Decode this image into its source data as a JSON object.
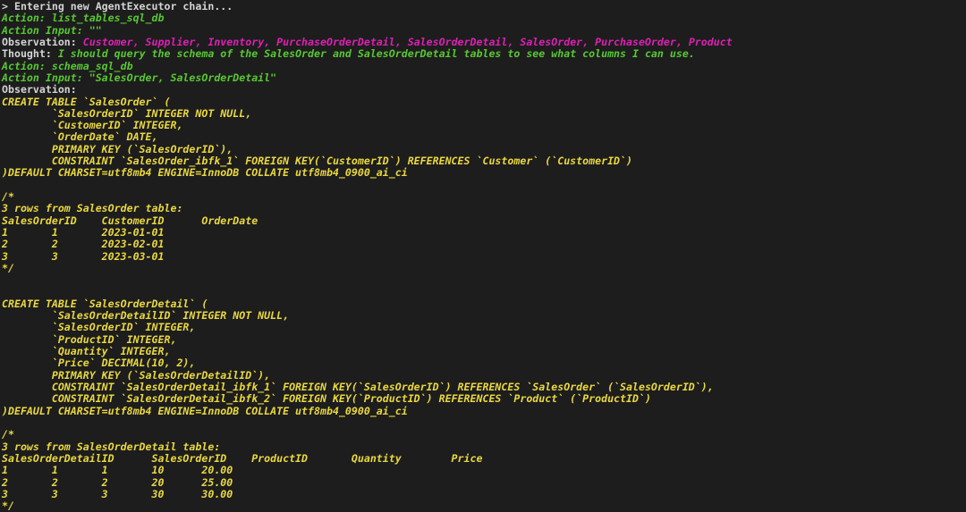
{
  "terminal": {
    "background_color": "#1d1d1d",
    "colors": {
      "plain": "#d4d4d4",
      "green": "#58c832",
      "magenta": "#de1fb5",
      "yellow": "#ead83f"
    },
    "lines": [
      {
        "id": "l0",
        "color": "plain",
        "text": "> Entering new AgentExecutor chain..."
      },
      {
        "id": "l1",
        "color": "green",
        "text": "Action: list_tables_sql_db"
      },
      {
        "id": "l2",
        "color": "green",
        "text": "Action Input: \"\""
      },
      {
        "id": "l3",
        "color": "plain",
        "text": "Observation: ",
        "suffix_color": "magenta",
        "suffix": "Customer, Supplier, Inventory, PurchaseOrderDetail, SalesOrderDetail, SalesOrder, PurchaseOrder, Product"
      },
      {
        "id": "l4",
        "color": "plain",
        "text": "Thought: ",
        "suffix_color": "green",
        "suffix": "I should query the schema of the SalesOrder and SalesOrderDetail tables to see what columns I can use."
      },
      {
        "id": "l5",
        "color": "green",
        "text": "Action: schema_sql_db"
      },
      {
        "id": "l6",
        "color": "green",
        "text": "Action Input: \"SalesOrder, SalesOrderDetail\""
      },
      {
        "id": "l7",
        "color": "plain",
        "text": "Observation:"
      },
      {
        "id": "l8",
        "color": "yellow",
        "text": "CREATE TABLE `SalesOrder` ("
      },
      {
        "id": "l9",
        "color": "yellow",
        "text": "        `SalesOrderID` INTEGER NOT NULL,"
      },
      {
        "id": "l10",
        "color": "yellow",
        "text": "        `CustomerID` INTEGER,"
      },
      {
        "id": "l11",
        "color": "yellow",
        "text": "        `OrderDate` DATE,"
      },
      {
        "id": "l12",
        "color": "yellow",
        "text": "        PRIMARY KEY (`SalesOrderID`),"
      },
      {
        "id": "l13",
        "color": "yellow",
        "text": "        CONSTRAINT `SalesOrder_ibfk_1` FOREIGN KEY(`CustomerID`) REFERENCES `Customer` (`CustomerID`)"
      },
      {
        "id": "l14",
        "color": "yellow",
        "text": ")DEFAULT CHARSET=utf8mb4 ENGINE=InnoDB COLLATE utf8mb4_0900_ai_ci"
      },
      {
        "id": "l15",
        "color": "yellow",
        "text": ""
      },
      {
        "id": "l16",
        "color": "yellow",
        "text": "/*"
      },
      {
        "id": "l17",
        "color": "yellow",
        "text": "3 rows from SalesOrder table:"
      },
      {
        "id": "l18",
        "color": "yellow",
        "text": "SalesOrderID    CustomerID      OrderDate"
      },
      {
        "id": "l19",
        "color": "yellow",
        "text": "1       1       2023-01-01"
      },
      {
        "id": "l20",
        "color": "yellow",
        "text": "2       2       2023-02-01"
      },
      {
        "id": "l21",
        "color": "yellow",
        "text": "3       3       2023-03-01"
      },
      {
        "id": "l22",
        "color": "yellow",
        "text": "*/"
      },
      {
        "id": "l23",
        "color": "yellow",
        "text": ""
      },
      {
        "id": "l24",
        "color": "yellow",
        "text": ""
      },
      {
        "id": "l25",
        "color": "yellow",
        "text": "CREATE TABLE `SalesOrderDetail` ("
      },
      {
        "id": "l26",
        "color": "yellow",
        "text": "        `SalesOrderDetailID` INTEGER NOT NULL,"
      },
      {
        "id": "l27",
        "color": "yellow",
        "text": "        `SalesOrderID` INTEGER,"
      },
      {
        "id": "l28",
        "color": "yellow",
        "text": "        `ProductID` INTEGER,"
      },
      {
        "id": "l29",
        "color": "yellow",
        "text": "        `Quantity` INTEGER,"
      },
      {
        "id": "l30",
        "color": "yellow",
        "text": "        `Price` DECIMAL(10, 2),"
      },
      {
        "id": "l31",
        "color": "yellow",
        "text": "        PRIMARY KEY (`SalesOrderDetailID`),"
      },
      {
        "id": "l32",
        "color": "yellow",
        "text": "        CONSTRAINT `SalesOrderDetail_ibfk_1` FOREIGN KEY(`SalesOrderID`) REFERENCES `SalesOrder` (`SalesOrderID`),"
      },
      {
        "id": "l33",
        "color": "yellow",
        "text": "        CONSTRAINT `SalesOrderDetail_ibfk_2` FOREIGN KEY(`ProductID`) REFERENCES `Product` (`ProductID`)"
      },
      {
        "id": "l34",
        "color": "yellow",
        "text": ")DEFAULT CHARSET=utf8mb4 ENGINE=InnoDB COLLATE utf8mb4_0900_ai_ci"
      },
      {
        "id": "l35",
        "color": "yellow",
        "text": ""
      },
      {
        "id": "l36",
        "color": "yellow",
        "text": "/*"
      },
      {
        "id": "l37",
        "color": "yellow",
        "text": "3 rows from SalesOrderDetail table:"
      },
      {
        "id": "l38",
        "color": "yellow",
        "text": "SalesOrderDetailID      SalesOrderID    ProductID       Quantity        Price"
      },
      {
        "id": "l39",
        "color": "yellow",
        "text": "1       1       1       10      20.00"
      },
      {
        "id": "l40",
        "color": "yellow",
        "text": "2       2       2       20      25.00"
      },
      {
        "id": "l41",
        "color": "yellow",
        "text": "3       3       3       30      30.00"
      },
      {
        "id": "l42",
        "color": "yellow",
        "text": "*/"
      }
    ],
    "agent_trace": {
      "header": "> Entering new AgentExecutor chain...",
      "steps": [
        {
          "action": "list_tables_sql_db",
          "action_input": "\"\"",
          "observation": "Customer, Supplier, Inventory, PurchaseOrderDetail, SalesOrderDetail, SalesOrder, PurchaseOrder, Product"
        },
        {
          "thought": "I should query the schema of the SalesOrder and SalesOrderDetail tables to see what columns I can use.",
          "action": "schema_sql_db",
          "action_input": "\"SalesOrder, SalesOrderDetail\"",
          "observation": ""
        }
      ],
      "tables_listed": [
        "Customer",
        "Supplier",
        "Inventory",
        "PurchaseOrderDetail",
        "SalesOrderDetail",
        "SalesOrder",
        "PurchaseOrder",
        "Product"
      ]
    },
    "schemas": [
      {
        "table": "SalesOrder",
        "columns": [
          "`SalesOrderID` INTEGER NOT NULL",
          "`CustomerID` INTEGER",
          "`OrderDate` DATE"
        ],
        "primary_key": "PRIMARY KEY (`SalesOrderID`)",
        "constraints": [
          "CONSTRAINT `SalesOrder_ibfk_1` FOREIGN KEY(`CustomerID`) REFERENCES `Customer` (`CustomerID`)"
        ],
        "table_options": ")DEFAULT CHARSET=utf8mb4 ENGINE=InnoDB COLLATE utf8mb4_0900_ai_ci",
        "sample_caption": "3 rows from SalesOrder table:",
        "sample_headers": [
          "SalesOrderID",
          "CustomerID",
          "OrderDate"
        ],
        "sample_rows": [
          [
            "1",
            "1",
            "2023-01-01"
          ],
          [
            "2",
            "2",
            "2023-02-01"
          ],
          [
            "3",
            "3",
            "2023-03-01"
          ]
        ]
      },
      {
        "table": "SalesOrderDetail",
        "columns": [
          "`SalesOrderDetailID` INTEGER NOT NULL",
          "`SalesOrderID` INTEGER",
          "`ProductID` INTEGER",
          "`Quantity` INTEGER",
          "`Price` DECIMAL(10, 2)"
        ],
        "primary_key": "PRIMARY KEY (`SalesOrderDetailID`)",
        "constraints": [
          "CONSTRAINT `SalesOrderDetail_ibfk_1` FOREIGN KEY(`SalesOrderID`) REFERENCES `SalesOrder` (`SalesOrderID`)",
          "CONSTRAINT `SalesOrderDetail_ibfk_2` FOREIGN KEY(`ProductID`) REFERENCES `Product` (`ProductID`)"
        ],
        "table_options": ")DEFAULT CHARSET=utf8mb4 ENGINE=InnoDB COLLATE utf8mb4_0900_ai_ci",
        "sample_caption": "3 rows from SalesOrderDetail table:",
        "sample_headers": [
          "SalesOrderDetailID",
          "SalesOrderID",
          "ProductID",
          "Quantity",
          "Price"
        ],
        "sample_rows": [
          [
            "1",
            "1",
            "1",
            "10",
            "20.00"
          ],
          [
            "2",
            "2",
            "2",
            "20",
            "25.00"
          ],
          [
            "3",
            "3",
            "3",
            "30",
            "30.00"
          ]
        ]
      }
    ]
  }
}
